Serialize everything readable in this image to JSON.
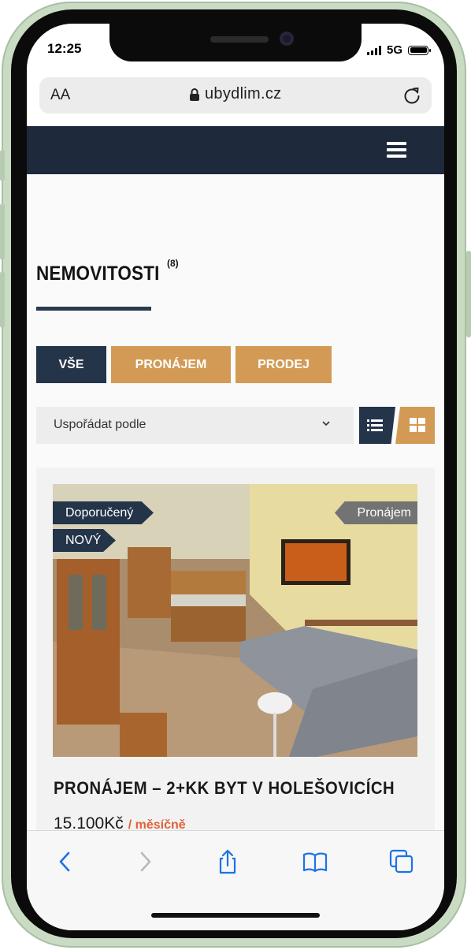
{
  "status_bar": {
    "time": "12:25",
    "network": "5G"
  },
  "browser": {
    "text_size_label": "AA",
    "url": "ubydlim.cz"
  },
  "page": {
    "title": "NEMOVITOSTI",
    "count": "(8)"
  },
  "filters": {
    "all": "VŠE",
    "rent": "PRONÁJEM",
    "sale": "PRODEJ"
  },
  "sort": {
    "label": "Uspořádat podle"
  },
  "listing": {
    "tag_featured": "Doporučený",
    "tag_new": "NOVÝ",
    "tag_type": "Pronájem",
    "title": "PRONÁJEM – 2+KK BYT V HOLEŠOVICÍCH",
    "price": "15.100Kč",
    "price_period": "/ měsíčně"
  },
  "colors": {
    "navy": "#243449",
    "accent_orange": "#d39a55",
    "price_period": "#e0633a",
    "ios_blue": "#1a73e8"
  },
  "icons": [
    "lock-icon",
    "reload-icon",
    "hamburger-icon",
    "chevron-down-icon",
    "list-view-icon",
    "grid-view-icon",
    "back-icon",
    "forward-icon",
    "share-icon",
    "bookmarks-icon",
    "tabs-icon"
  ]
}
